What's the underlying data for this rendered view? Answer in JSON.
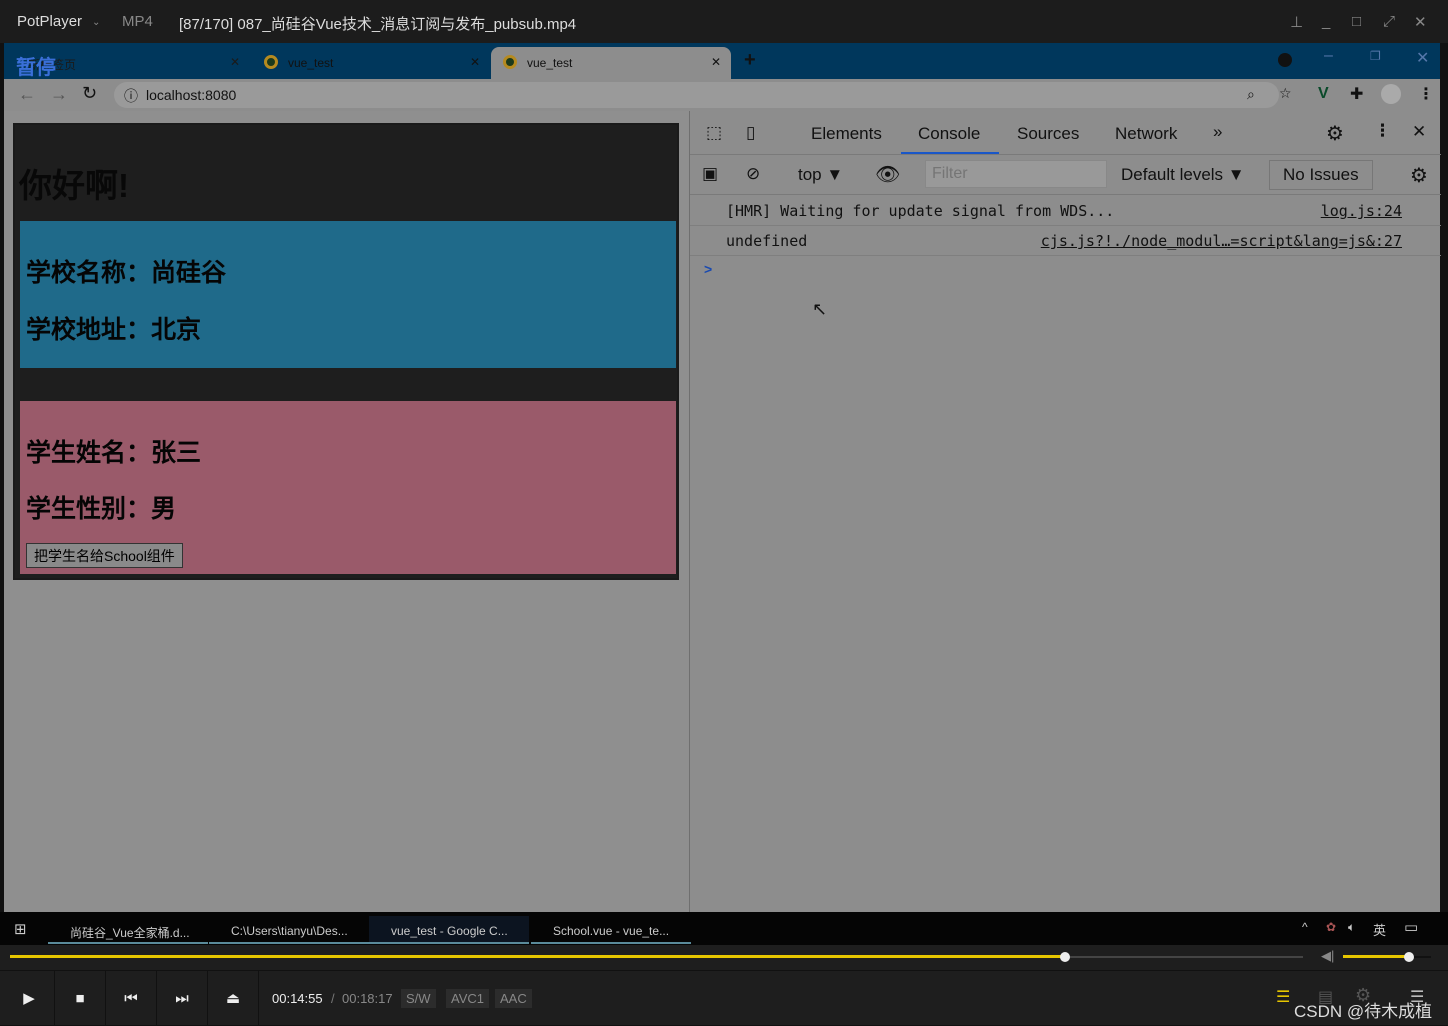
{
  "player": {
    "app": "PotPlayer",
    "format": "MP4",
    "title": "[87/170] 087_尚硅谷Vue技术_消息订阅与发布_pubsub.mp4",
    "paused_osd": "暂停",
    "current_time": "00:14:55",
    "total_time": "00:18:17",
    "badges": [
      "S/W",
      "AVC1",
      "AAC"
    ],
    "progress_percent": 81.6,
    "volume_percent": 75,
    "watermark": "CSDN @待木成植"
  },
  "browser": {
    "tabs": [
      {
        "label": "新标签页"
      },
      {
        "label": "vue_test"
      },
      {
        "label": "vue_test",
        "active": true
      }
    ],
    "url": "localhost:8080"
  },
  "app": {
    "heading": "你好啊!",
    "school_name": "学校名称：尚硅谷",
    "school_address": "学校地址：北京",
    "student_name": "学生姓名：张三",
    "student_gender": "学生性别：男",
    "button": "把学生名给School组件",
    "colors": {
      "school_bg": "#1f6a8a",
      "student_bg": "#9a5a6a"
    }
  },
  "devtools": {
    "tabs": [
      "Elements",
      "Console",
      "Sources",
      "Network"
    ],
    "active_tab": "Console",
    "context": "top",
    "filter_placeholder": "Filter",
    "levels": "Default levels",
    "issues": "No Issues",
    "logs": [
      {
        "message": "[HMR] Waiting for update signal from WDS...",
        "source": "log.js:24"
      },
      {
        "message": "undefined",
        "source": "cjs.js?!./node_modul…=script&lang=js&:27"
      }
    ],
    "prompt": ">"
  },
  "taskbar": {
    "items": [
      "尚硅谷_Vue全家桶.d...",
      "C:\\Users\\tianyu\\Des...",
      "vue_test - Google C...",
      "School.vue - vue_te..."
    ],
    "ime": "英"
  }
}
